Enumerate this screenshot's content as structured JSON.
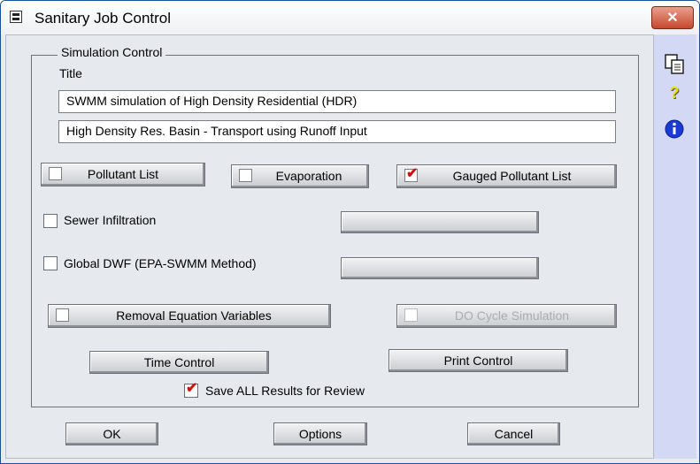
{
  "window": {
    "title": "Sanitary Job Control",
    "close_glyph": "✕"
  },
  "simulation": {
    "group_label": "Simulation Control",
    "title_label": "Title",
    "title_line1": "SWMM  simulation of High Density Residential (HDR)",
    "title_line2": "High Density Res. Basin - Transport using Runoff Input"
  },
  "options": {
    "pollutant_list": {
      "label": "Pollutant List",
      "checked": false
    },
    "evaporation": {
      "label": "Evaporation",
      "checked": false
    },
    "gauged_pollutant_list": {
      "label": "Gauged Pollutant List",
      "checked": true
    },
    "sewer_infiltration": {
      "label": "Sewer Infiltration",
      "checked": false
    },
    "global_dwf": {
      "label": "Global DWF (EPA-SWMM Method)",
      "checked": false
    },
    "removal_equation": {
      "label": "Removal Equation Variables",
      "checked": false
    },
    "do_cycle": {
      "label": "DO Cycle Simulation",
      "checked": false,
      "enabled": false
    },
    "time_control": {
      "label": "Time Control"
    },
    "print_control": {
      "label": "Print Control"
    },
    "save_all": {
      "label": "Save ALL Results for Review",
      "checked": true
    }
  },
  "footer": {
    "ok": "OK",
    "options": "Options",
    "cancel": "Cancel"
  },
  "toolbar": {
    "icons": [
      "copy-icon",
      "help-icon",
      "info-icon"
    ],
    "help_glyph": "?",
    "info_glyph": "i"
  },
  "colors": {
    "check_red": "#d01010",
    "close_red": "#c8472e",
    "toolbar_bg": "#d3d8f5"
  }
}
